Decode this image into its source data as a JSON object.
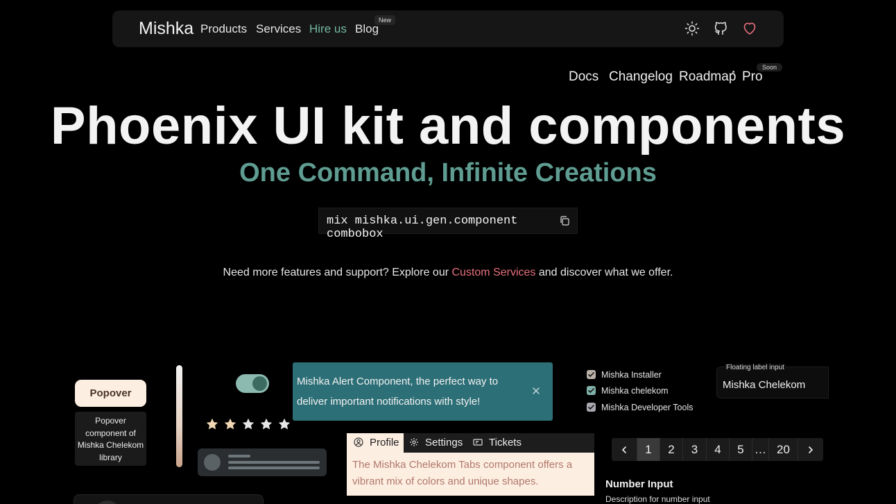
{
  "nav": {
    "brand": "Mishka",
    "links": [
      "Products",
      "Services",
      "Hire us",
      "Blog"
    ],
    "new_badge": "New",
    "icons": [
      "sun-icon",
      "github-icon",
      "heart-icon"
    ],
    "heart_color": "#e8707f"
  },
  "subnav": {
    "links": [
      "Docs",
      "Changelog",
      "Roadmap",
      "Pro"
    ],
    "soon_badge": "Soon"
  },
  "hero": {
    "title": "Phoenix UI kit and components",
    "subtitle": "One Command, Infinite Creations",
    "command": "mix mishka.ui.gen.component combobox",
    "tagline_before": "Need more features and support? Explore our ",
    "tagline_link": "Custom Services",
    "tagline_after": " and discover what we offer."
  },
  "demo": {
    "popover_button": "Popover",
    "popover_text": "Popover component of Mishka Chelekom library",
    "toggle_on": true,
    "rating": {
      "value": 2,
      "max": 5
    },
    "alert": {
      "text": "Mishka Alert Component, the perfect way to deliver important notifications with style!",
      "color": "#2d6f77"
    },
    "tabs": {
      "items": [
        "Profile",
        "Settings",
        "Tickets"
      ],
      "active": "Profile",
      "panel_text": "The Mishka Chelekom Tabs component offers a vibrant mix of colors and unique shapes."
    },
    "checkboxes": [
      {
        "label": "Mishka Installer",
        "checked": true,
        "color": "#b9b0a8"
      },
      {
        "label": "Mishka chelekom",
        "checked": true,
        "color": "#7fb1a8"
      },
      {
        "label": "Mishka Developer Tools",
        "checked": true,
        "color": "#a8a8b0"
      }
    ],
    "floating_input": {
      "label": "Floating label input",
      "value": "Mishka Chelekom"
    },
    "pagination": {
      "pages": [
        "1",
        "2",
        "3",
        "4",
        "5",
        "…",
        "20"
      ],
      "active": "1"
    },
    "number_input": {
      "title": "Number Input",
      "description": "Description for number input"
    }
  }
}
